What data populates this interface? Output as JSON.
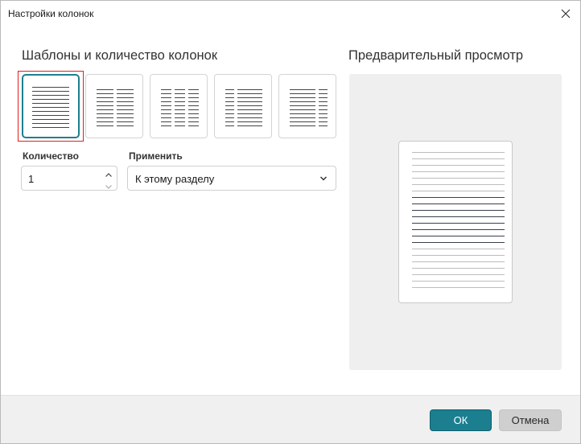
{
  "dialog": {
    "title": "Настройки колонок"
  },
  "templates": {
    "heading": "Шаблоны и количество колонок",
    "items": [
      {
        "columns": 1,
        "selected": true
      },
      {
        "columns": 2,
        "selected": false
      },
      {
        "columns": 3,
        "selected": false
      },
      {
        "columns": "left-narrow",
        "selected": false
      },
      {
        "columns": "right-narrow",
        "selected": false
      }
    ]
  },
  "count": {
    "label": "Количество",
    "value": "1"
  },
  "apply": {
    "label": "Применить",
    "value": "К этому разделу"
  },
  "preview": {
    "heading": "Предварительный просмотр"
  },
  "buttons": {
    "ok": "ОК",
    "cancel": "Отмена"
  },
  "colors": {
    "accent": "#1b7f90",
    "selection_outline": "#e02020"
  },
  "icons": {
    "close": "close-icon",
    "spin_up": "chevron-up-icon",
    "spin_down": "chevron-down-icon",
    "select": "chevron-down-icon"
  }
}
